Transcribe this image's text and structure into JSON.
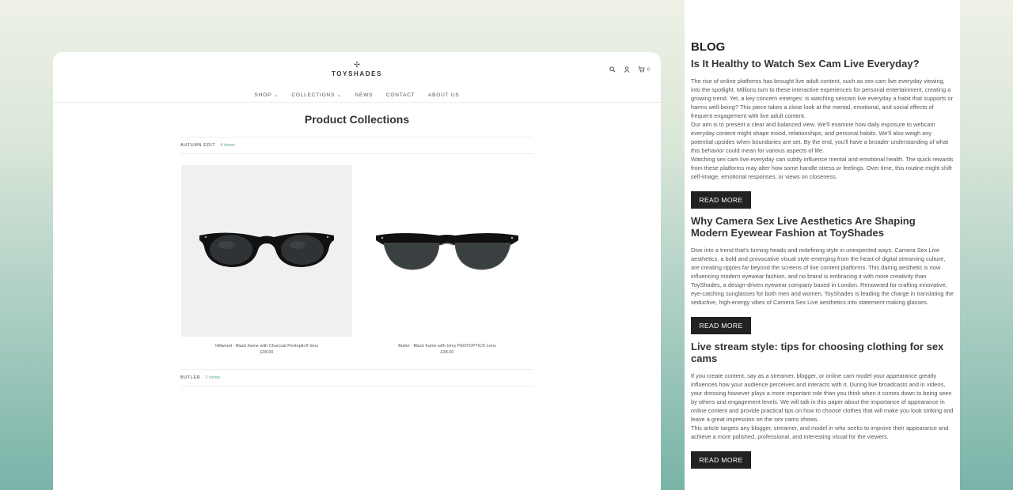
{
  "store": {
    "logo_mark": "✢",
    "logo_text": "TOYSHADES",
    "cart_count": "0",
    "nav": [
      "SHOP ⌄",
      "COLLECTIONS ⌄",
      "NEWS",
      "CONTACT",
      "ABOUT US"
    ],
    "page_title": "Product Collections",
    "collections": [
      {
        "name": "AUTUMN EDIT",
        "count": "4 items"
      },
      {
        "name": "BUTLER",
        "count": "2 items"
      }
    ],
    "products": [
      {
        "name": "Hillwood - Black frame with Charcoal Pentoptic® lens",
        "price": "£38.00"
      },
      {
        "name": "Butler - Black frame with Grey PENTOPTIC® Lens",
        "price": "£38.00"
      }
    ]
  },
  "blog": {
    "heading": "BLOG",
    "read_more_label": "READ MORE",
    "posts": [
      {
        "title": "Is It Healthy to Watch Sex Cam Live Everyday?",
        "paragraphs": [
          "The rise of online platforms has brought live adult content, such as sex cam live everyday viewing, into the spotlight. Millions turn to these interactive experiences for personal entertainment, creating a growing trend. Yet, a key concern emerges: is watching sexcam live everyday a habit that supports or harms well-being? This piece takes a close look at the mental, emotional, and social effects of frequent engagement with live adult content.",
          "Our aim is to present a clear and balanced view. We'll examine how daily exposure to webcam everyday content might shape mood, relationships, and personal habits. We'll also weigh any potential upsides when boundaries are set. By the end, you'll have a broader understanding of what this behavior could mean for various aspects of life.",
          "Watching sex cam live everyday can subtly influence mental and emotional health. The quick rewards from these platforms may alter how some handle stress or feelings. Over time, this routine might shift self-image, emotional responses, or views on closeness."
        ]
      },
      {
        "title": "Why Camera Sex Live Aesthetics Are Shaping Modern Eyewear Fashion at ToyShades",
        "paragraphs": [
          "Dive into a trend that's turning heads and redefining style in unexpected ways. Camera Sex Live aesthetics, a bold and provocative visual style emerging from the heart of digital streaming culture, are creating ripples far beyond the screens of live content platforms. This daring aesthetic is now influencing modern eyewear fashion, and no brand is embracing it with more creativity than ToyShades, a design-driven eyewear company based in London. Renowned for crafting innovative, eye-catching sunglasses for both men and women, ToyShades is leading the charge in translating the seductive, high-energy vibes of Camera Sex Live aesthetics into statement-making glasses."
        ]
      },
      {
        "title": "Live stream style: tips for choosing clothing for sex cams",
        "paragraphs": [
          "If you create content, say as a streamer, blogger, or online cam model your appearance greatly influences how your audience perceives and interacts with it. During live broadcasts and in videos, your dressing however plays a more important role than you think when it comes down to being seen by others and engagement levels. We will talk in this paper about the importance of appearance in online content and provide practical tips on how to choose clothes that will make you look striking and leave a great impression on the sex cams shows.",
          "This article targets any blogger, streamer, and model in who seeks to improve their appearance and achieve a more polished, professional, and interesting visual for the viewers."
        ]
      }
    ]
  }
}
